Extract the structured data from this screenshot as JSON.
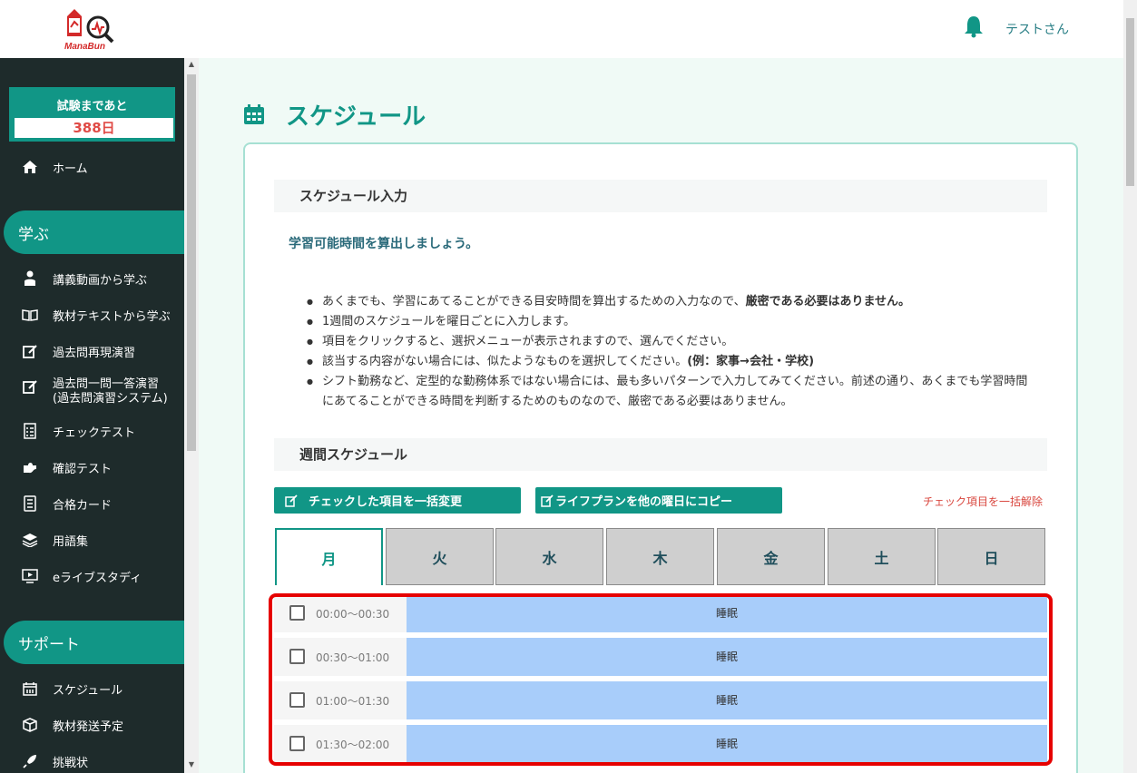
{
  "header": {
    "logo_text": "ManaBun",
    "username": "テストさん"
  },
  "sidebar": {
    "exam_countdown_title": "試験まであと",
    "exam_countdown_days": "388日",
    "home_label": "ホーム",
    "section_learn": "学ぶ",
    "learn_items": [
      {
        "label": "講義動画から学ぶ",
        "icon": "teacher-icon"
      },
      {
        "label": "教材テキストから学ぶ",
        "icon": "book-icon"
      },
      {
        "label": "過去問再現演習",
        "icon": "edit-icon"
      },
      {
        "label": "過去問一問一答演習\n(過去問演習システム)",
        "icon": "edit-icon"
      },
      {
        "label": "チェックテスト",
        "icon": "checklist-icon"
      },
      {
        "label": "確認テスト",
        "icon": "puzzle-icon"
      },
      {
        "label": "合格カード",
        "icon": "cards-icon"
      },
      {
        "label": "用語集",
        "icon": "layers-icon"
      },
      {
        "label": "eライブスタディ",
        "icon": "monitor-icon"
      }
    ],
    "section_support": "サポート",
    "support_items": [
      {
        "label": "スケジュール",
        "icon": "calendar-icon"
      },
      {
        "label": "教材発送予定",
        "icon": "box-icon"
      },
      {
        "label": "挑戦状",
        "icon": "rocket-icon"
      }
    ]
  },
  "main": {
    "page_title": "スケジュール",
    "input_section_title": "スケジュール入力",
    "lead": "学習可能時間を算出しましょう。",
    "bullets": [
      {
        "text": "あくまでも、学習にあてることができる目安時間を算出するための入力なので、",
        "bold": "厳密である必要はありません。"
      },
      {
        "text": "1週間のスケジュールを曜日ごとに入力します。",
        "bold": ""
      },
      {
        "text": "項目をクリックすると、選択メニューが表示されますので、選んでください。",
        "bold": ""
      },
      {
        "text": "該当する内容がない場合には、似たようなものを選択してください。",
        "bold": "(例：家事→会社・学校)"
      },
      {
        "text": "シフト勤務など、定型的な勤務体系ではない場合には、最も多いパターンで入力してみてください。前述の通り、あくまでも学習時間にあてることができる時間を判断するためのものなので、厳密である必要はありません。",
        "bold": ""
      }
    ],
    "weekly_section_title": "週間スケジュール",
    "bulk_change_button": "チェックした項目を一括変更",
    "copy_button": "ライフプランを他の曜日にコピー",
    "reset_link": "チェック項目を一括解除",
    "days": [
      "月",
      "火",
      "水",
      "木",
      "金",
      "土",
      "日"
    ],
    "active_day": "月",
    "slots": [
      {
        "time": "00:00〜00:30",
        "activity": "睡眠",
        "checked": false
      },
      {
        "time": "00:30〜01:00",
        "activity": "睡眠",
        "checked": false
      },
      {
        "time": "01:00〜01:30",
        "activity": "睡眠",
        "checked": false
      },
      {
        "time": "01:30〜02:00",
        "activity": "睡眠",
        "checked": false
      }
    ]
  },
  "colors": {
    "accent": "#119686",
    "sidebar_bg": "#1e2b2b",
    "activity_sleep": "#a8cdfa",
    "highlight": "#e60000",
    "countdown": "#e04a45"
  }
}
